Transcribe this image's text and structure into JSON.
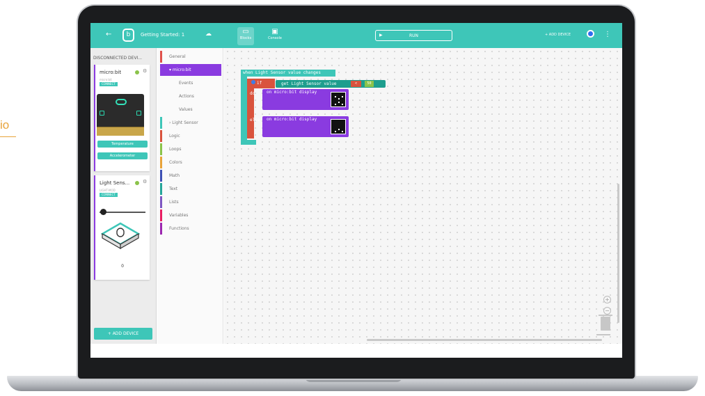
{
  "stray_text": "io",
  "topbar": {
    "project_title": "Getting Started: 1",
    "modes": [
      {
        "label": "Blocks"
      },
      {
        "label": "Console"
      }
    ],
    "run_label": "RUN",
    "add_device_label": "+ ADD DEVICE"
  },
  "sidebar": {
    "title": "DISCONNECTED DEVI...",
    "devices": [
      {
        "name": "micro:bit",
        "subtitle": "micro:bit",
        "connect": "CONNECT",
        "buttons": [
          "Temperature",
          "Accelerometer"
        ]
      },
      {
        "name": "Light Sens...",
        "subtitle": "LIGHT-MOD",
        "connect": "CONNECT",
        "value": "0"
      }
    ],
    "add_device": "+ ADD DEVICE"
  },
  "toolbox": {
    "categories": [
      {
        "label": "General"
      },
      {
        "label": "▾ micro:bit",
        "active": true
      },
      {
        "label": "Events",
        "sub": true
      },
      {
        "label": "Actions",
        "sub": true
      },
      {
        "label": "Values",
        "sub": true
      },
      {
        "label": "› Light Sensor"
      },
      {
        "label": "Logic"
      },
      {
        "label": "Loops"
      },
      {
        "label": "Colors"
      },
      {
        "label": "Math"
      },
      {
        "label": "Text"
      },
      {
        "label": "Lists"
      },
      {
        "label": "Variables"
      },
      {
        "label": "Functions"
      }
    ],
    "colors": [
      "#e0514b",
      "#8a3be0",
      "#8a3be0",
      "#8a3be0",
      "#8a3be0",
      "#3ec6b8",
      "#d9533d",
      "#8bc34a",
      "#e8a33a",
      "#3f51b5",
      "#26a69a",
      "#7e57c2",
      "#e91e63",
      "#9c27b0"
    ]
  },
  "workspace": {
    "event_block": "when Light Sensor value changes",
    "if_label": "if",
    "do_label": "do",
    "else_label": "else",
    "gauge_block": "get Light Sensor value",
    "operator": "<",
    "threshold": "50",
    "display_block_1": "on micro:bit display",
    "display_block_2": "on micro:bit display",
    "zoom_in": "+",
    "zoom_out": "−",
    "zoom_reset": "○"
  }
}
